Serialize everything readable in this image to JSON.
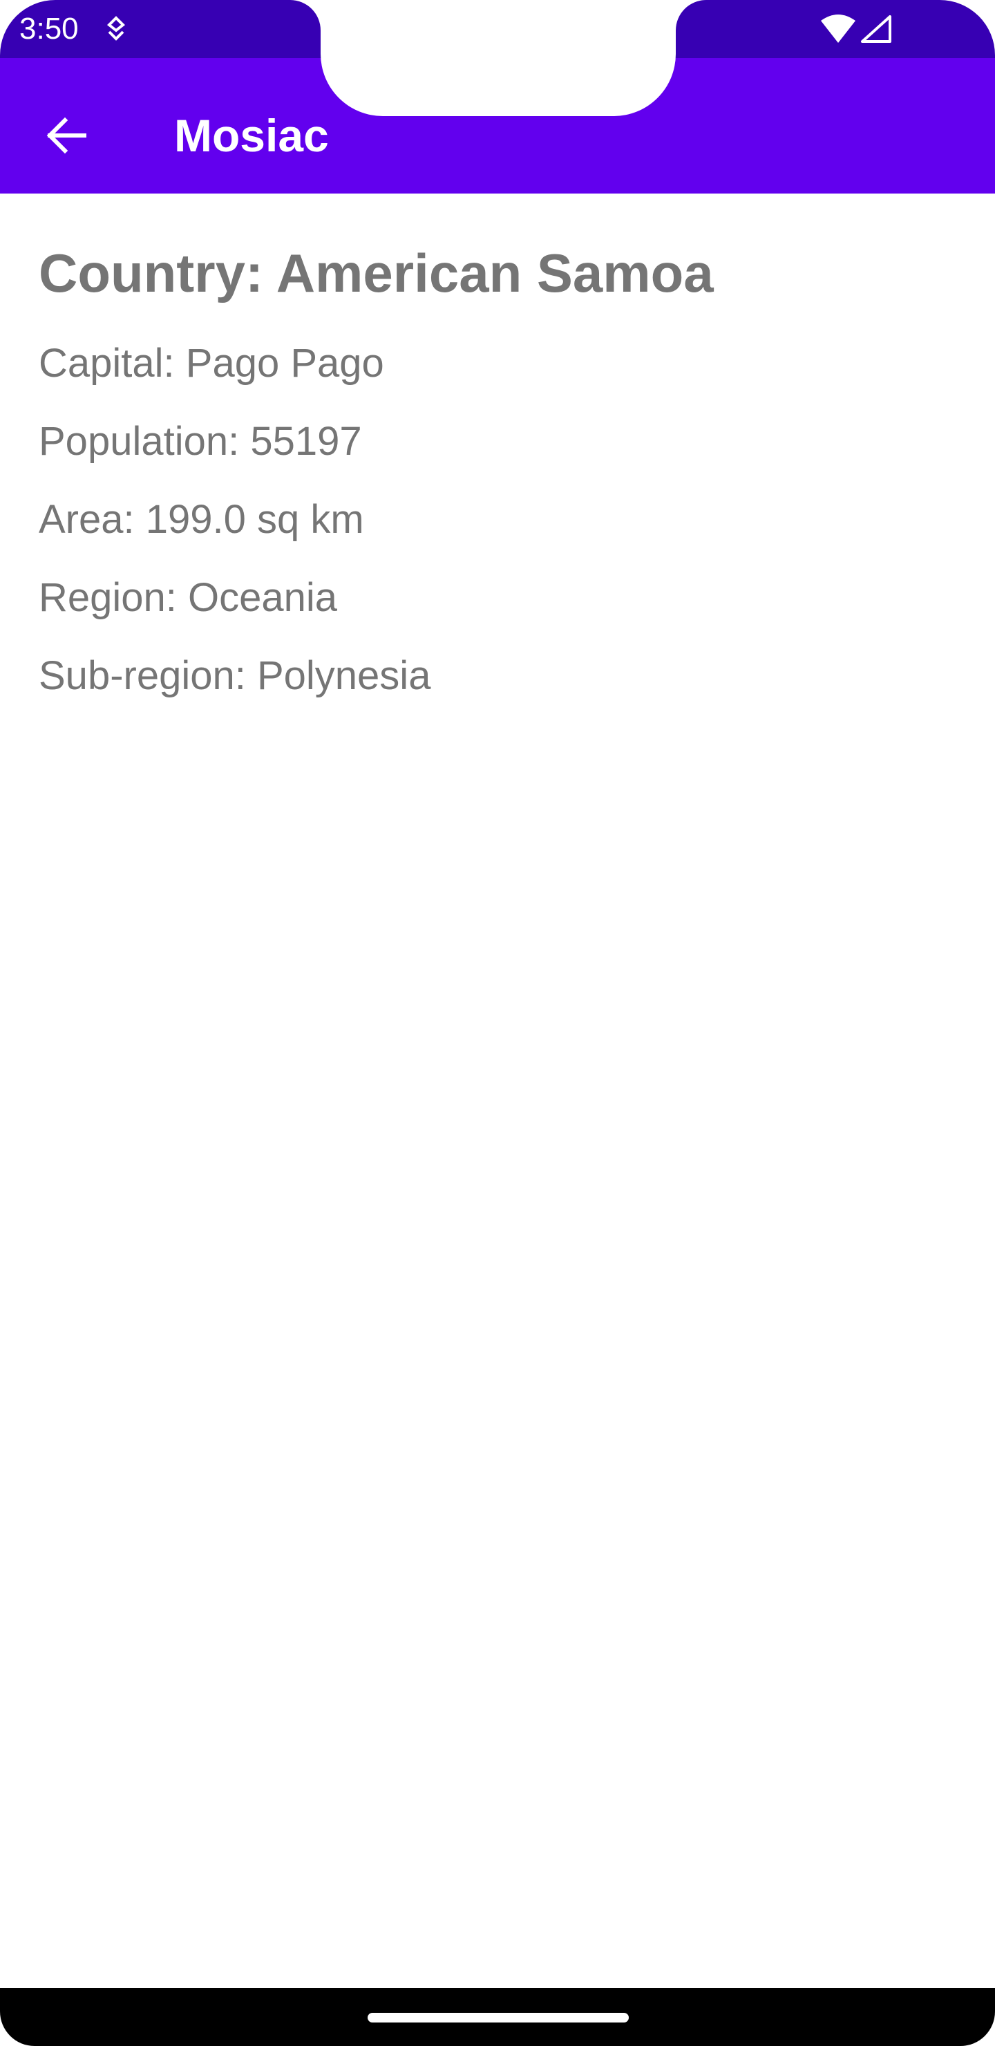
{
  "status_bar": {
    "time": "3:50",
    "icons": [
      "notification-icon",
      "wifi-icon",
      "signal-icon"
    ]
  },
  "app_bar": {
    "title": "Mosiac",
    "back_icon": "arrow-back-icon"
  },
  "country": {
    "title": "Country: American Samoa",
    "capital": "Capital: Pago Pago",
    "population": "Population: 55197",
    "area": "Area: 199.0 sq km",
    "region": "Region: Oceania",
    "subregion": "Sub-region: Polynesia"
  },
  "colors": {
    "status_bar": "#3700b3",
    "app_bar": "#6200ee",
    "text": "#757575",
    "nav_bar": "#000000"
  }
}
